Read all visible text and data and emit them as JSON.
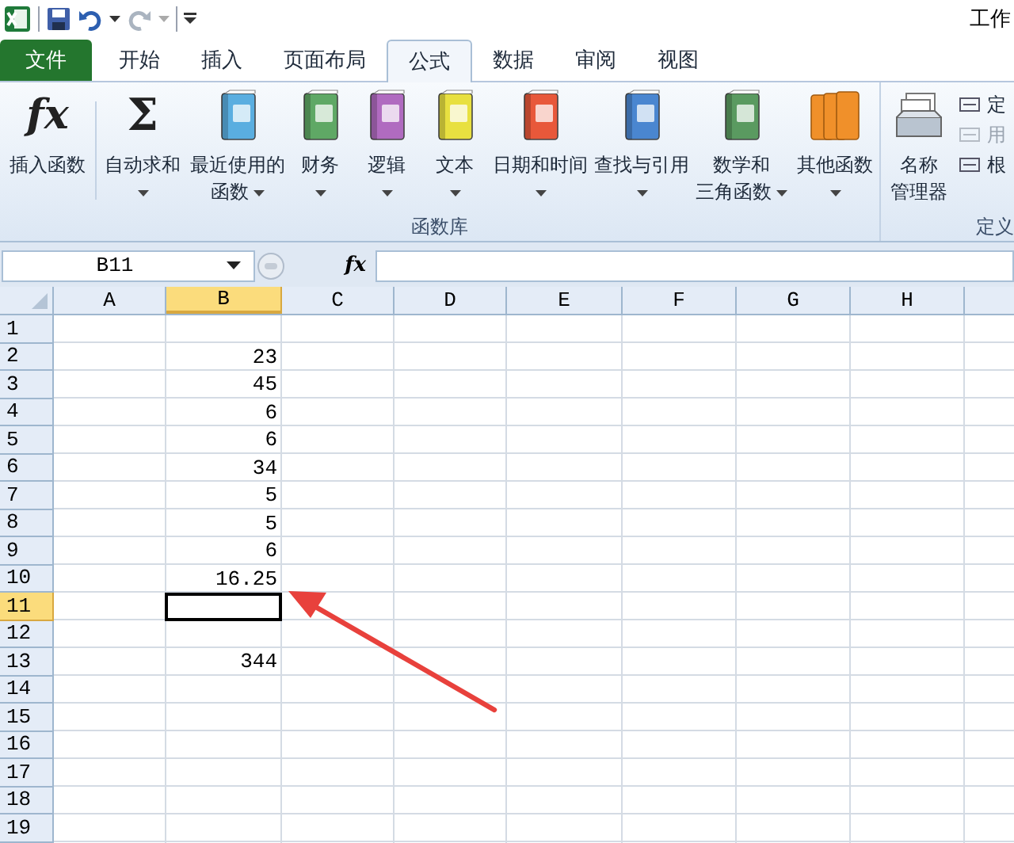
{
  "title_bar": {
    "title": "工作"
  },
  "tabs": [
    {
      "label": "文件",
      "kind": "file",
      "selected": false
    },
    {
      "label": "开始",
      "kind": "tab",
      "selected": false
    },
    {
      "label": "插入",
      "kind": "tab",
      "selected": false
    },
    {
      "label": "页面布局",
      "kind": "tab",
      "selected": false
    },
    {
      "label": "公式",
      "kind": "tab",
      "selected": true
    },
    {
      "label": "数据",
      "kind": "tab",
      "selected": false
    },
    {
      "label": "审阅",
      "kind": "tab",
      "selected": false
    },
    {
      "label": "视图",
      "kind": "tab",
      "selected": false
    }
  ],
  "ribbon": {
    "function_library": {
      "label": "函数库",
      "items": [
        {
          "lines": [
            "插入函数"
          ],
          "kind": "fx",
          "glyph": "fx",
          "dropdown": false
        },
        {
          "lines": [
            "自动求和"
          ],
          "kind": "sigma",
          "glyph": "Σ",
          "dropdown": true
        },
        {
          "lines": [
            "最近使用的",
            "函数"
          ],
          "kind": "book",
          "color": "#5aaee0",
          "dropdown": true
        },
        {
          "lines": [
            "财务"
          ],
          "kind": "book",
          "color": "#5fa865",
          "dropdown": true
        },
        {
          "lines": [
            "逻辑"
          ],
          "kind": "book",
          "color": "#b06bc0",
          "dropdown": true
        },
        {
          "lines": [
            "文本"
          ],
          "kind": "book",
          "color": "#e8e040",
          "dropdown": true
        },
        {
          "lines": [
            "日期和时间"
          ],
          "kind": "book",
          "color": "#e8583a",
          "dropdown": true
        },
        {
          "lines": [
            "查找与引用"
          ],
          "kind": "book",
          "color": "#4a86d0",
          "dropdown": true
        },
        {
          "lines": [
            "数学和",
            "三角函数"
          ],
          "kind": "book",
          "color": "#5a9a60",
          "dropdown": true
        },
        {
          "lines": [
            "其他函数"
          ],
          "kind": "books",
          "color": "#f0902a",
          "dropdown": true
        }
      ]
    },
    "defined_names": {
      "label": "定义",
      "manager": [
        "名称",
        "管理器"
      ],
      "items": [
        {
          "label": "定",
          "disabled": false
        },
        {
          "label": "用",
          "disabled": true
        },
        {
          "label": "根",
          "disabled": false
        }
      ]
    }
  },
  "formula_bar": {
    "name_box": "B11",
    "function_glyph": "fx"
  },
  "sheet": {
    "columns": [
      {
        "label": "A",
        "selected": false
      },
      {
        "label": "B",
        "selected": true
      },
      {
        "label": "C",
        "selected": false
      },
      {
        "label": "D",
        "selected": false
      },
      {
        "label": "E",
        "selected": false
      },
      {
        "label": "F",
        "selected": false
      },
      {
        "label": "G",
        "selected": false
      },
      {
        "label": "H",
        "selected": false
      }
    ],
    "rows": [
      {
        "label": "1",
        "selected": false
      },
      {
        "label": "2",
        "selected": false,
        "B": "23"
      },
      {
        "label": "3",
        "selected": false,
        "B": "45"
      },
      {
        "label": "4",
        "selected": false,
        "B": "6"
      },
      {
        "label": "5",
        "selected": false,
        "B": "6"
      },
      {
        "label": "6",
        "selected": false,
        "B": "34"
      },
      {
        "label": "7",
        "selected": false,
        "B": "5"
      },
      {
        "label": "8",
        "selected": false,
        "B": "5"
      },
      {
        "label": "9",
        "selected": false,
        "B": "6"
      },
      {
        "label": "10",
        "selected": false,
        "B": "16.25"
      },
      {
        "label": "11",
        "selected": true
      },
      {
        "label": "12",
        "selected": false
      },
      {
        "label": "13",
        "selected": false,
        "B": "344"
      },
      {
        "label": "14",
        "selected": false
      },
      {
        "label": "15",
        "selected": false
      },
      {
        "label": "16",
        "selected": false
      },
      {
        "label": "17",
        "selected": false
      },
      {
        "label": "18",
        "selected": false
      },
      {
        "label": "19",
        "selected": false
      }
    ]
  }
}
